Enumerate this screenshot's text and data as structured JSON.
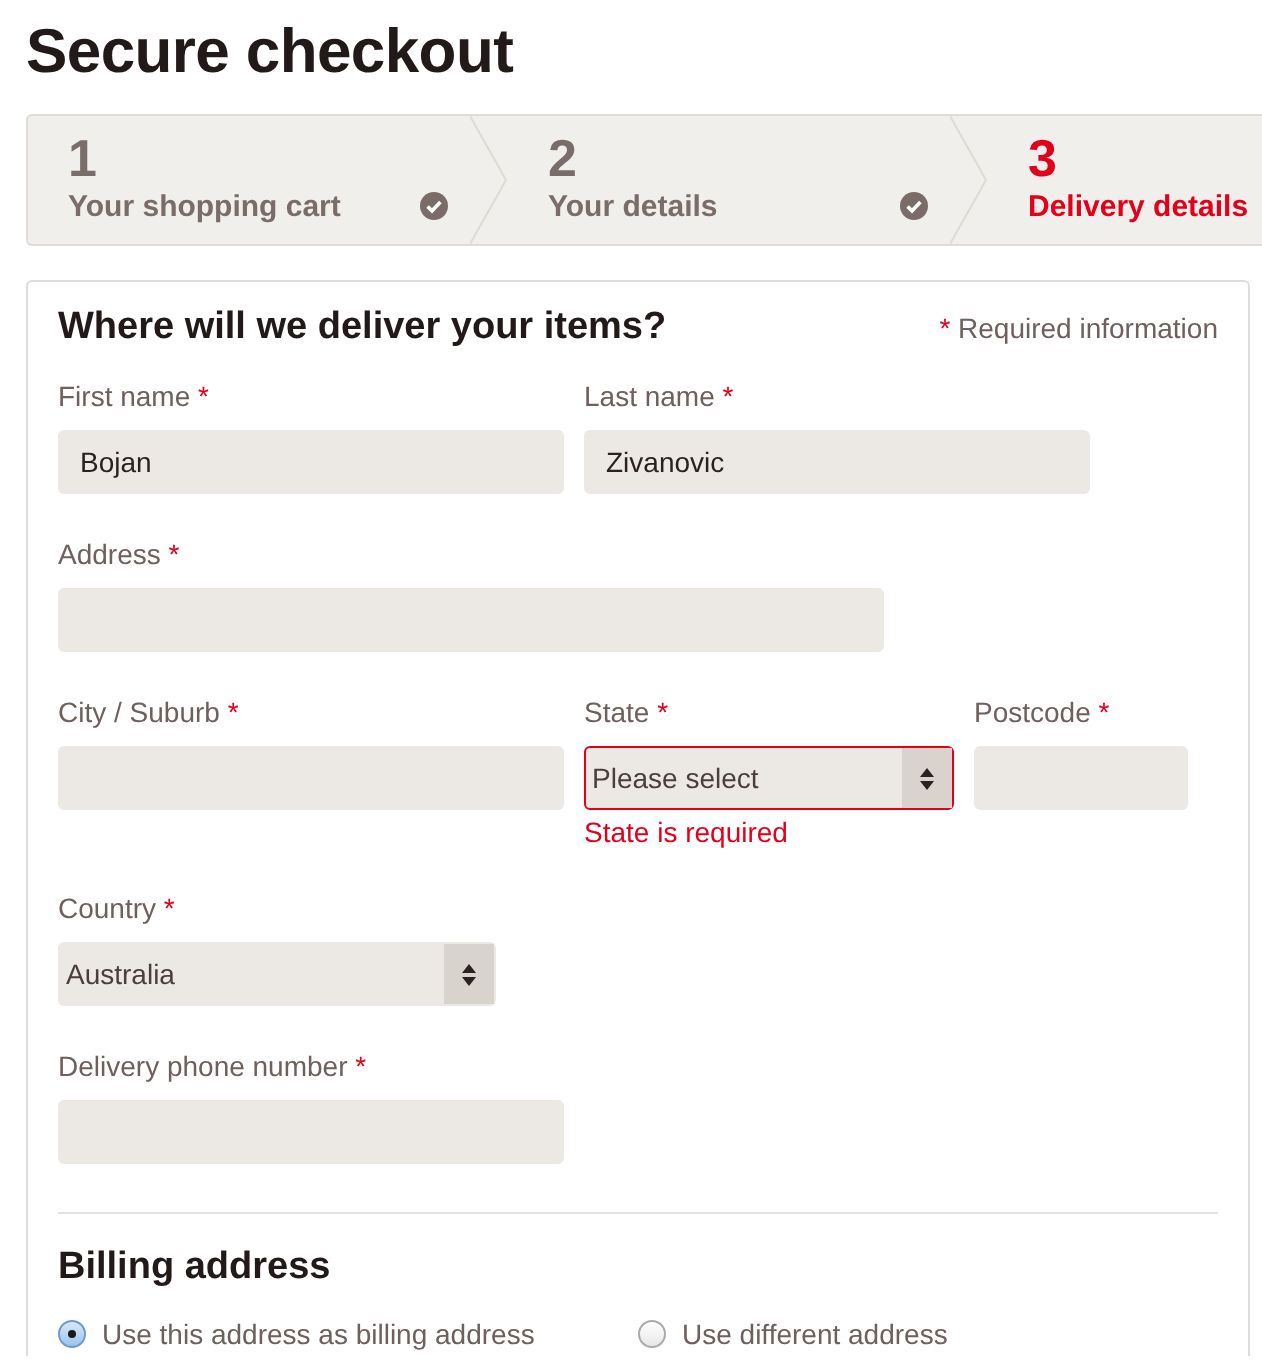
{
  "page_title": "Secure checkout",
  "steps": [
    {
      "number": "1",
      "label": "Your shopping cart",
      "done": true,
      "selected": false
    },
    {
      "number": "2",
      "label": "Your details",
      "done": true,
      "selected": false
    },
    {
      "number": "3",
      "label": "Delivery details",
      "done": false,
      "selected": true
    }
  ],
  "form": {
    "heading": "Where will we deliver your items?",
    "required_note": {
      "mark": "*",
      "text": "Required information"
    },
    "rows": [
      [
        {
          "kind": "text",
          "label": "First name",
          "mark": "*",
          "value": "Bojan"
        },
        {
          "kind": "text",
          "label": "Last name",
          "mark": "*",
          "value": "Zivanovic"
        }
      ],
      [
        {
          "kind": "text",
          "label": "Address",
          "mark": "*"
        }
      ],
      [
        {
          "kind": "text",
          "label": "City / Suburb",
          "mark": "*"
        },
        {
          "kind": "select",
          "label": "State",
          "mark": "*",
          "value": "Please select",
          "invalid": true,
          "error": "State is required"
        },
        {
          "kind": "text",
          "label": "Postcode",
          "mark": "*"
        }
      ],
      [
        {
          "kind": "select",
          "label": "Country",
          "mark": "*",
          "value": "Australia",
          "invalid": false
        }
      ],
      [
        {
          "kind": "text",
          "label": "Delivery phone number",
          "mark": "*"
        }
      ]
    ]
  },
  "billing": {
    "heading": "Billing address",
    "options": [
      {
        "label": "Use this address as billing address",
        "selected": true
      },
      {
        "label": "Use different address",
        "selected": false
      }
    ]
  }
}
